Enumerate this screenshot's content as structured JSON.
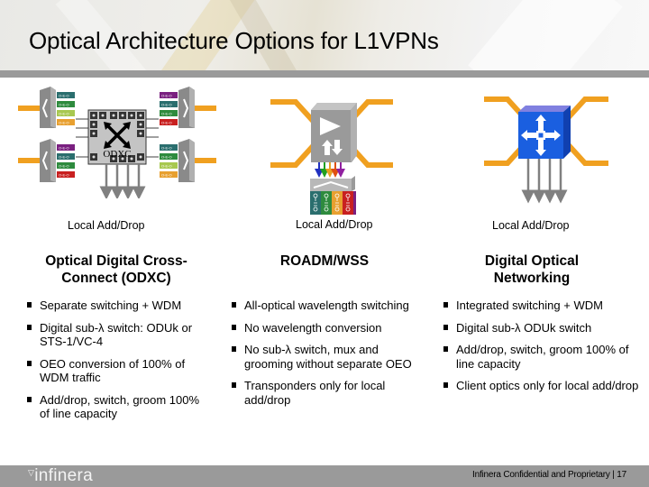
{
  "header": {
    "title": "Optical Architecture Options for L1VPNs"
  },
  "columns": [
    {
      "diagram": {
        "device_label": "ODXC",
        "caption": "Local Add/Drop",
        "transponder_label": "O-E-O"
      },
      "title": "Optical Digital Cross-\nConnect (ODXC)",
      "title_lines": [
        "Optical Digital Cross-",
        "Connect (ODXC)"
      ],
      "bullets": [
        "Separate switching + WDM",
        "Digital sub-λ switch: ODUk or STS-1/VC-4",
        "OEO conversion of 100% of WDM traffic",
        "Add/drop, switch, groom 100% of line capacity"
      ]
    },
    {
      "diagram": {
        "caption": "Local Add/Drop",
        "transponder_label": "O-E-O"
      },
      "title_lines": [
        "ROADM/WSS"
      ],
      "bullets": [
        "All-optical wavelength switching",
        "No wavelength conversion",
        "No sub-λ switch, mux and grooming without separate OEO",
        "Transponders only for local add/drop"
      ]
    },
    {
      "diagram": {
        "caption": "Local Add/Drop"
      },
      "title_lines": [
        "Digital Optical",
        "Networking"
      ],
      "bullets": [
        "Integrated switching + WDM",
        "Digital sub-λ ODUk switch",
        "Add/drop, switch, groom 100% of line capacity",
        "Client optics only for local add/drop"
      ]
    }
  ],
  "colors": {
    "fiber": "#f0a020",
    "dol_blue": "#1a5fe0",
    "transponders": [
      "#2a6e6e",
      "#2e8b3e",
      "#a8c850",
      "#e8a030",
      "#7a2080",
      "#c82020"
    ]
  },
  "footer": {
    "logo": "infinera",
    "text": "Infinera Confidential and Proprietary  |  17"
  }
}
